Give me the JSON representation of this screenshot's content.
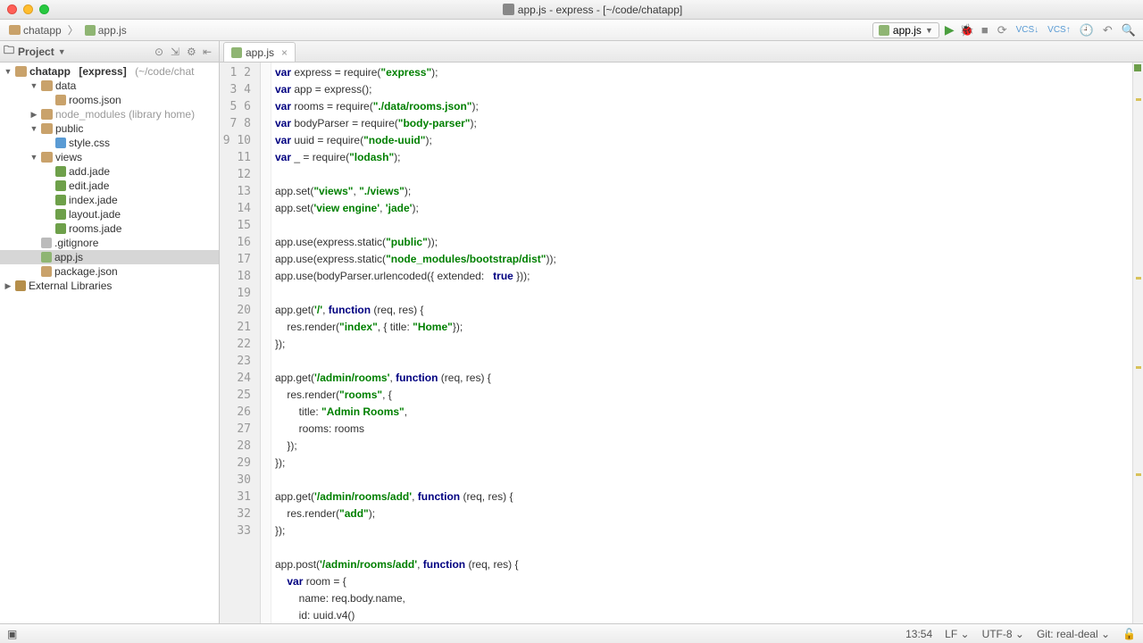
{
  "title": "app.js - express - [~/code/chatapp]",
  "breadcrumb": {
    "project": "chatapp",
    "file": "app.js"
  },
  "runconfig": "app.js",
  "project_root": {
    "name": "chatapp",
    "tag": "[express]",
    "hint": "(~/code/chat"
  },
  "tree": [
    {
      "lvl": 1,
      "type": "folder",
      "exp": true,
      "label": "data"
    },
    {
      "lvl": 2,
      "type": "json",
      "label": "rooms.json"
    },
    {
      "lvl": 1,
      "type": "folder",
      "exp": false,
      "label": "node_modules",
      "hint": "(library home)",
      "dim": true
    },
    {
      "lvl": 1,
      "type": "folder",
      "exp": true,
      "label": "public"
    },
    {
      "lvl": 2,
      "type": "css",
      "label": "style.css"
    },
    {
      "lvl": 1,
      "type": "folder",
      "exp": true,
      "label": "views"
    },
    {
      "lvl": 2,
      "type": "jade",
      "label": "add.jade"
    },
    {
      "lvl": 2,
      "type": "jade",
      "label": "edit.jade"
    },
    {
      "lvl": 2,
      "type": "jade",
      "label": "index.jade"
    },
    {
      "lvl": 2,
      "type": "jade",
      "label": "layout.jade"
    },
    {
      "lvl": 2,
      "type": "jade",
      "label": "rooms.jade"
    },
    {
      "lvl": 1,
      "type": "txt",
      "label": ".gitignore"
    },
    {
      "lvl": 1,
      "type": "js",
      "label": "app.js",
      "sel": true
    },
    {
      "lvl": 1,
      "type": "json",
      "label": "package.json"
    }
  ],
  "extlib": "External Libraries",
  "tab": "app.js",
  "code": {
    "first_line": 1,
    "total_visible": 33,
    "current_line": 13,
    "lines": [
      [
        [
          "kw",
          "var"
        ],
        [
          "",
          ""
        ],
        [
          "fn",
          " express = require("
        ],
        [
          "str",
          "\"express\""
        ],
        [
          "fn",
          ");"
        ]
      ],
      [
        [
          "kw",
          "var"
        ],
        [
          "fn",
          " app = express();"
        ]
      ],
      [
        [
          "kw",
          "var"
        ],
        [
          "fn",
          " rooms = require("
        ],
        [
          "str",
          "\"./data/rooms.json\""
        ],
        [
          "fn",
          ");"
        ]
      ],
      [
        [
          "kw",
          "var"
        ],
        [
          "fn",
          " bodyParser = require("
        ],
        [
          "str",
          "\"body-parser\""
        ],
        [
          "fn",
          ");"
        ]
      ],
      [
        [
          "kw",
          "var"
        ],
        [
          "fn",
          " uuid = require("
        ],
        [
          "str",
          "\"node-uuid\""
        ],
        [
          "fn",
          ");"
        ]
      ],
      [
        [
          "kw",
          "var"
        ],
        [
          "fn",
          " _ = require("
        ],
        [
          "str",
          "\"lodash\""
        ],
        [
          "fn",
          ");"
        ]
      ],
      [
        [
          "",
          ""
        ]
      ],
      [
        [
          "fn",
          "app.set("
        ],
        [
          "str",
          "\"views\""
        ],
        [
          "fn",
          ", "
        ],
        [
          "str",
          "\"./views\""
        ],
        [
          "fn",
          ");"
        ]
      ],
      [
        [
          "fn",
          "app.set("
        ],
        [
          "str",
          "'view engine'"
        ],
        [
          "fn",
          ", "
        ],
        [
          "str",
          "'jade'"
        ],
        [
          "fn",
          ");"
        ]
      ],
      [
        [
          "",
          ""
        ]
      ],
      [
        [
          "fn",
          "app.use(express.static("
        ],
        [
          "str",
          "\"public\""
        ],
        [
          "fn",
          "));"
        ]
      ],
      [
        [
          "fn",
          "app.use(express.static("
        ],
        [
          "str",
          "\"node_modules/bootstrap/dist\""
        ],
        [
          "fn",
          "));"
        ]
      ],
      [
        [
          "fn",
          "app.use(bodyParser.urlencoded({ extended:   "
        ],
        [
          "lit",
          "true"
        ],
        [
          "fn",
          " }));"
        ]
      ],
      [
        [
          "",
          ""
        ]
      ],
      [
        [
          "fn",
          "app.get("
        ],
        [
          "str",
          "'/'"
        ],
        [
          "fn",
          ", "
        ],
        [
          "kw",
          "function"
        ],
        [
          "fn",
          " (req, res) {"
        ]
      ],
      [
        [
          "fn",
          "    res.render("
        ],
        [
          "str",
          "\"index\""
        ],
        [
          "fn",
          ", { title: "
        ],
        [
          "str",
          "\"Home\""
        ],
        [
          "fn",
          "});"
        ]
      ],
      [
        [
          "fn",
          "});"
        ]
      ],
      [
        [
          "",
          ""
        ]
      ],
      [
        [
          "fn",
          "app.get("
        ],
        [
          "str",
          "'/admin/rooms'"
        ],
        [
          "fn",
          ", "
        ],
        [
          "kw",
          "function"
        ],
        [
          "fn",
          " (req, res) {"
        ]
      ],
      [
        [
          "fn",
          "    res.render("
        ],
        [
          "str",
          "\"rooms\""
        ],
        [
          "fn",
          ", {"
        ]
      ],
      [
        [
          "fn",
          "        title: "
        ],
        [
          "str",
          "\"Admin Rooms\""
        ],
        [
          "fn",
          ","
        ]
      ],
      [
        [
          "fn",
          "        rooms: rooms"
        ]
      ],
      [
        [
          "fn",
          "    });"
        ]
      ],
      [
        [
          "fn",
          "});"
        ]
      ],
      [
        [
          "",
          ""
        ]
      ],
      [
        [
          "fn",
          "app.get("
        ],
        [
          "str",
          "'/admin/rooms/add'"
        ],
        [
          "fn",
          ", "
        ],
        [
          "kw",
          "function"
        ],
        [
          "fn",
          " (req, res) {"
        ]
      ],
      [
        [
          "fn",
          "    res.render("
        ],
        [
          "str",
          "\"add\""
        ],
        [
          "fn",
          ");"
        ]
      ],
      [
        [
          "fn",
          "});"
        ]
      ],
      [
        [
          "",
          ""
        ]
      ],
      [
        [
          "fn",
          "app.post("
        ],
        [
          "str",
          "'/admin/rooms/add'"
        ],
        [
          "fn",
          ", "
        ],
        [
          "kw",
          "function"
        ],
        [
          "fn",
          " (req, res) {"
        ]
      ],
      [
        [
          "fn",
          "    "
        ],
        [
          "kw",
          "var"
        ],
        [
          "fn",
          " room = {"
        ]
      ],
      [
        [
          "fn",
          "        name: req.body.name,"
        ]
      ],
      [
        [
          "fn",
          "        id: uuid.v4()"
        ]
      ]
    ]
  },
  "status": {
    "cursor": "13:54",
    "lf": "LF",
    "encoding": "UTF-8",
    "git": "Git: real-deal"
  }
}
